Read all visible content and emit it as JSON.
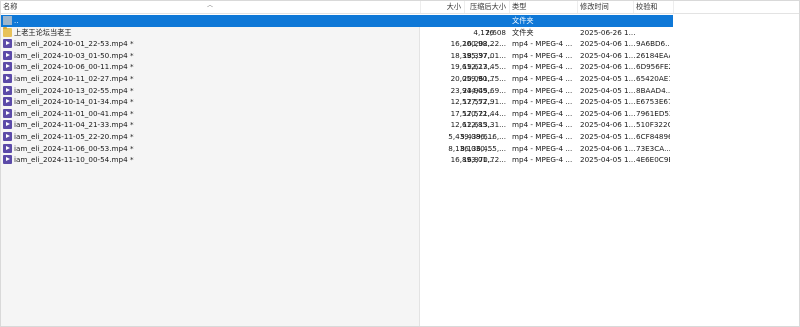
{
  "columns": {
    "name": "名称",
    "size": "大小",
    "packed_size": "压缩后大小",
    "type": "类型",
    "modified": "修改时间",
    "checksum": "校验和"
  },
  "rows": [
    {
      "name": "..",
      "size": "",
      "packed_size": "",
      "type": "文件夹",
      "modified": "",
      "checksum": "",
      "icon": "up-folder-icon",
      "selected": true
    },
    {
      "name": "上老王论坛当老王",
      "size": "4,176",
      "packed_size": "2,608",
      "type": "文件夹",
      "modified": "2025-06-26 1...",
      "checksum": "",
      "icon": "folder-icon",
      "selected": false
    },
    {
      "name": "iam_eli_2024-10-01_22-53.mp4 *",
      "size": "16,200,98...",
      "packed_size": "16,202,22...",
      "type": "mp4 - MPEG-4 ...",
      "modified": "2025-04-06 1...",
      "checksum": "9A6BD6...",
      "icon": "media-file-icon",
      "selected": false
    },
    {
      "name": "iam_eli_2024-10-03_01-50.mp4 *",
      "size": "18,395,37...",
      "packed_size": "18,397,01...",
      "type": "mp4 - MPEG-4 ...",
      "modified": "2025-04-06 1...",
      "checksum": "26184EAA",
      "icon": "media-file-icon",
      "selected": false
    },
    {
      "name": "iam_eli_2024-10-06_00-11.mp4 *",
      "size": "19,612,27...",
      "packed_size": "19,613,45...",
      "type": "mp4 - MPEG-4 ...",
      "modified": "2025-04-06 1...",
      "checksum": "6D956FE2",
      "icon": "media-file-icon",
      "selected": false
    },
    {
      "name": "iam_eli_2024-10-11_02-27.mp4 *",
      "size": "20,059,90...",
      "packed_size": "20,061,75...",
      "type": "mp4 - MPEG-4 ...",
      "modified": "2025-04-05 1...",
      "checksum": "65420AE1",
      "icon": "media-file-icon",
      "selected": false
    },
    {
      "name": "iam_eli_2024-10-13_02-55.mp4 *",
      "size": "23,944,09...",
      "packed_size": "23,945,69...",
      "type": "mp4 - MPEG-4 ...",
      "modified": "2025-04-05 1...",
      "checksum": "8BAAD4...",
      "icon": "media-file-icon",
      "selected": false
    },
    {
      "name": "iam_eli_2024-10-14_01-34.mp4 *",
      "size": "12,577,52...",
      "packed_size": "12,577,91...",
      "type": "mp4 - MPEG-4 ...",
      "modified": "2025-04-05 1...",
      "checksum": "E6753E67",
      "icon": "media-file-icon",
      "selected": false
    },
    {
      "name": "iam_eli_2024-11-01_00-41.mp4 *",
      "size": "17,520,72...",
      "packed_size": "17,521,44...",
      "type": "mp4 - MPEG-4 ...",
      "modified": "2025-04-06 1...",
      "checksum": "7961ED52",
      "icon": "media-file-icon",
      "selected": false
    },
    {
      "name": "iam_eli_2024-11-04_21-33.mp4 *",
      "size": "12,612,85...",
      "packed_size": "12,613,31...",
      "type": "mp4 - MPEG-4 ...",
      "modified": "2025-04-06 1...",
      "checksum": "510F322C",
      "icon": "media-file-icon",
      "selected": false
    },
    {
      "name": "iam_eli_2024-11-05_22-20.mp4 *",
      "size": "5,439,086,...",
      "packed_size": "5,439,616,...",
      "type": "mp4 - MPEG-4 ...",
      "modified": "2025-04-05 1...",
      "checksum": "6CF84896",
      "icon": "media-file-icon",
      "selected": false
    },
    {
      "name": "iam_eli_2024-11-06_00-53.mp4 *",
      "size": "8,136,030,...",
      "packed_size": "8,136,455,...",
      "type": "mp4 - MPEG-4 ...",
      "modified": "2025-04-06 1...",
      "checksum": "73E3CA...",
      "icon": "media-file-icon",
      "selected": false
    },
    {
      "name": "iam_eli_2024-11-10_00-54.mp4 *",
      "size": "16,893,01...",
      "packed_size": "16,870,72...",
      "type": "mp4 - MPEG-4 ...",
      "modified": "2025-04-05 1...",
      "checksum": "4E6E0C9B",
      "icon": "media-file-icon",
      "selected": false
    }
  ]
}
